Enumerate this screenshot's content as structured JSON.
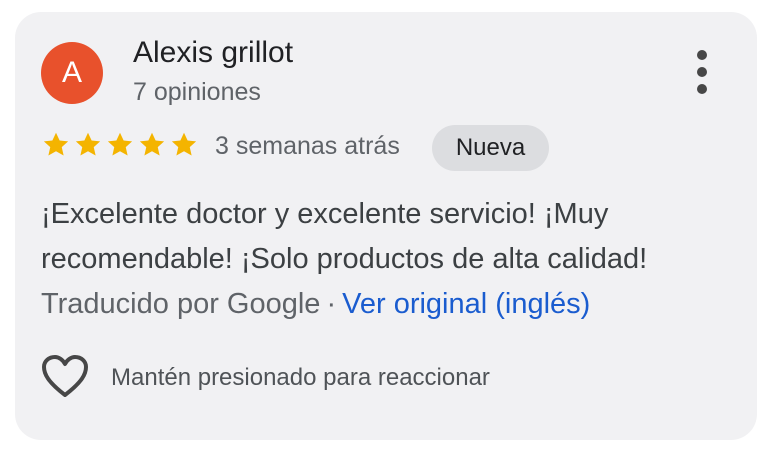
{
  "review": {
    "avatar_initial": "A",
    "author_name": "Alexis grillot",
    "review_count": "7 opiniones",
    "rating": 5,
    "time_ago": "3 semanas atrás",
    "badge": "Nueva",
    "text": "¡Excelente doctor y excelente servicio! ¡Muy recomendable! ¡Solo productos de alta calidad!",
    "translated_by": "Traducido por Google",
    "separator": "·",
    "view_original": "Ver original (inglés)",
    "react_hint": "Mantén presionado para reaccionar"
  },
  "icons": {
    "more": "more-vert-icon",
    "star": "star-icon",
    "heart": "heart-outline-icon"
  },
  "colors": {
    "card_background": "#f1f1f3",
    "avatar": "#e8512c",
    "star": "#f4b400",
    "link": "#1a5ccf",
    "badge_background": "#dcdde0"
  }
}
